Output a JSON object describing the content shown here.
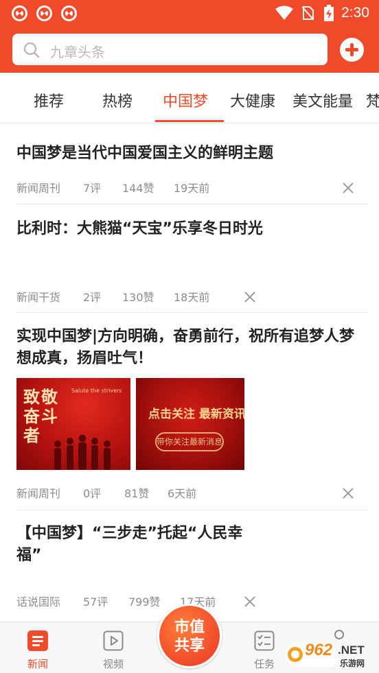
{
  "status_bar": {
    "time": "2:30",
    "app_icons": [
      "app-notification-icon",
      "app-notification-icon",
      "app-notification-icon"
    ]
  },
  "search": {
    "placeholder": "九章头条"
  },
  "tabs": [
    {
      "label": "推荐",
      "active": false
    },
    {
      "label": "热榜",
      "active": false
    },
    {
      "label": "中国梦",
      "active": true
    },
    {
      "label": "大健康",
      "active": false
    },
    {
      "label": "美文能量",
      "active": false
    },
    {
      "label": "梵",
      "active": false
    }
  ],
  "articles": [
    {
      "title": "中国梦是当代中国爱国主义的鲜明主题",
      "source": "新闻周刊",
      "comments": "7评",
      "likes": "144赞",
      "time": "19天前"
    },
    {
      "title": "比利时：大熊猫“天宝”乐享冬日时光",
      "source": "新闻干货",
      "comments": "2评",
      "likes": "130赞",
      "time": "18天前"
    },
    {
      "title": "实现中国梦|方向明确，奋勇前行，祝所有追梦人梦想成真，扬眉吐气！",
      "source": "新闻周刊",
      "comments": "0评",
      "likes": "81赞",
      "time": "6天前",
      "images": [
        {
          "main_text": "致敬奋斗者",
          "sub_text": "Salute the strivers"
        },
        {
          "main_text": "点击关注 最新资讯",
          "sub_text": "带你关注最新消息"
        }
      ]
    },
    {
      "title": "【中国梦】“三步走”托起“人民幸福”",
      "source": "话说国际",
      "comments": "57评",
      "likes": "799赞",
      "time": "17天前"
    }
  ],
  "bottom_nav": {
    "items": [
      {
        "label": "新闻",
        "icon": "news-icon",
        "active": true
      },
      {
        "label": "视频",
        "icon": "video-icon",
        "active": false
      },
      {
        "label": "任务",
        "icon": "task-icon",
        "active": false
      }
    ],
    "center_button": {
      "line1": "市值",
      "line2": "共享"
    }
  },
  "watermark": {
    "number": "962",
    "suffix": ".NET",
    "sub": "乐游网"
  },
  "colors": {
    "brand": "#f04a2a",
    "text": "#222222",
    "meta": "#8c8c8c"
  }
}
